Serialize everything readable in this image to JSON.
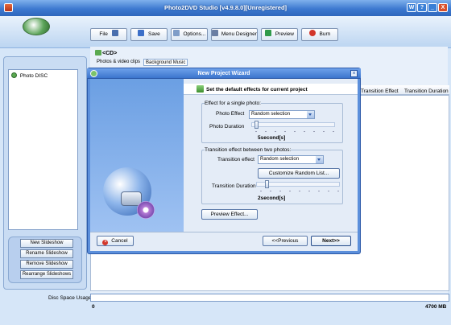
{
  "window": {
    "title": "Photo2DVD Studio [v4.9.8.0][Unregistered]",
    "controls": [
      "W",
      "?",
      "_",
      "X"
    ]
  },
  "toolbar": {
    "file": "File",
    "save": "Save",
    "options": "Options...",
    "menu_designer": "Menu Designer",
    "preview": "Preview",
    "burn": "Burn"
  },
  "sidebar": {
    "tree_item": "Photo DISC",
    "buttons": [
      "New Slideshow",
      "Rename Slideshow",
      "Remove Slideshow",
      "Rearrange Slideshows"
    ]
  },
  "main": {
    "cd_label": "<CD>",
    "tabs": [
      "Photos & video clips",
      "Background Music"
    ],
    "columns": [
      "Transition Effect",
      "Transition Duration"
    ]
  },
  "status": {
    "disk_label": "Disc Space Usage:",
    "min": "0",
    "max": "4700 MB"
  },
  "wizard": {
    "title": "New Project Wizard",
    "heading": "Set the default effects for current project",
    "single_photo_group": "Effect for a single photo:",
    "photo_effect_label": "Photo Effect",
    "photo_effect_value": "Random selection",
    "photo_duration_label": "Photo Duration",
    "photo_duration_value": "5second[s]",
    "transition_group": "Transition effect between two photos:",
    "transition_effect_label": "Transition effect",
    "transition_effect_value": "Random selection",
    "customize_label": "Customize Random List...",
    "transition_duration_label": "Transition Duration",
    "transition_duration_value": "2second[s]",
    "preview_label": "Preview Effect...",
    "cancel_label": "Cancel",
    "previous_label": "<<Previous",
    "next_label": "Next>>"
  },
  "colors": {
    "titlebar": "#3d79d0",
    "accent": "#5b8fdb"
  }
}
